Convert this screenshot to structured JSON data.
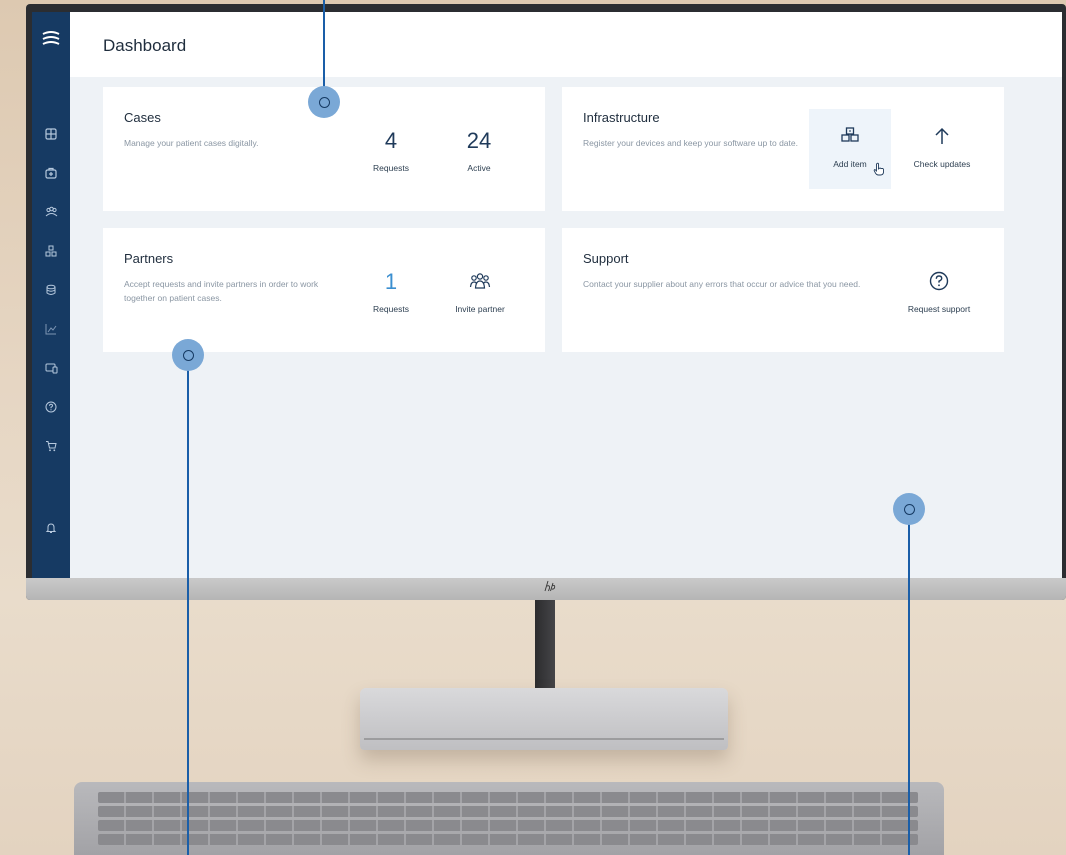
{
  "page": {
    "title": "Dashboard"
  },
  "sidebar": {
    "items": [
      {
        "icon": "dashboard-icon"
      },
      {
        "icon": "cases-icon"
      },
      {
        "icon": "partners-icon"
      },
      {
        "icon": "infrastructure-icon"
      },
      {
        "icon": "database-icon"
      },
      {
        "icon": "analytics-icon"
      },
      {
        "icon": "devices-icon"
      },
      {
        "icon": "help-icon"
      },
      {
        "icon": "cart-icon"
      },
      {
        "icon": "notifications-icon"
      }
    ]
  },
  "cards": {
    "cases": {
      "title": "Cases",
      "description": "Manage your patient cases digitally.",
      "stats": [
        {
          "value": "4",
          "label": "Requests"
        },
        {
          "value": "24",
          "label": "Active"
        }
      ]
    },
    "infrastructure": {
      "title": "Infrastructure",
      "description": "Register your devices and keep your software up to date.",
      "actions": [
        {
          "label": "Add item",
          "icon": "add-item-icon"
        },
        {
          "label": "Check updates",
          "icon": "arrow-up-icon"
        }
      ]
    },
    "partners": {
      "title": "Partners",
      "description": "Accept requests and invite partners in order to work together on patient cases.",
      "stats": [
        {
          "value": "1",
          "label": "Requests"
        }
      ],
      "actions": [
        {
          "label": "Invite partner",
          "icon": "invite-partner-icon"
        }
      ]
    },
    "support": {
      "title": "Support",
      "description": "Contact your supplier about any errors that occur or advice that you need.",
      "actions": [
        {
          "label": "Request support",
          "icon": "question-icon"
        }
      ]
    }
  },
  "colors": {
    "sidebar": "#163a63",
    "accent": "#3b8fd0",
    "callout": "#7aa8d6",
    "callout_line": "#1a5ea8"
  }
}
